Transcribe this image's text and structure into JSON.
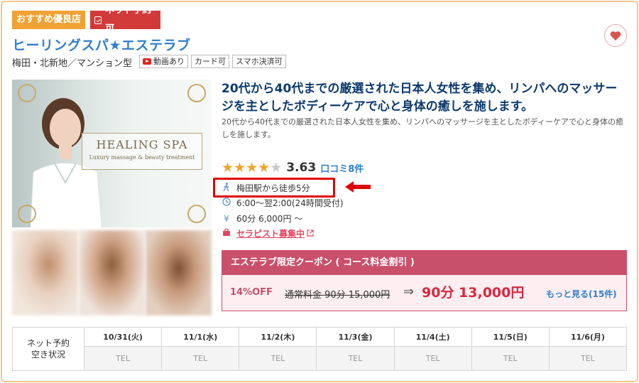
{
  "badges": {
    "recommended": "おすすめ優良店",
    "net_reserve": "ネット予約可"
  },
  "shop": {
    "name": "ヒーリングスパ★エステラブ",
    "area": "梅田・北新地／マンション型",
    "tags": [
      "動画あり",
      "カード可",
      "スマホ決済可"
    ]
  },
  "photo": {
    "title": "HEALING SPA",
    "subtitle": "Luxury massage & beauty treatment"
  },
  "headline": "20代から40代までの厳選された日本人女性を集め、リンパへのマッサージを主としたボディーケアで心と身体の癒しを施します。",
  "description": "20代から40代までの厳選された日本人女性を集め、リンパへのマッサージを主としたボディーケアで心と身体の癒しを施します。",
  "rating": {
    "stars": 4,
    "max": 5,
    "score": "3.63",
    "reviews": "口コミ8件"
  },
  "info": {
    "access": "梅田駅から徒歩5分",
    "hours": "6:00〜翌2:00(24時間受付)",
    "price": "60分 6,000円 〜",
    "recruit": "セラピスト募集中"
  },
  "coupon": {
    "header": "エステラブ限定クーポン ( コース料金割引 )",
    "discount": "14%OFF",
    "regular": "通常料金 90分 15,000円",
    "arrow": "⇒",
    "new_price": "90分 13,000円",
    "more": "もっと見る(15件)"
  },
  "schedule": {
    "label_line1": "ネット予約",
    "label_line2": "空き状況",
    "days": [
      "10/31(火)",
      "11/1(水)",
      "11/2(木)",
      "11/3(金)",
      "11/4(土)",
      "11/5(日)",
      "11/6(月)"
    ],
    "slots": [
      "TEL",
      "TEL",
      "TEL",
      "TEL",
      "TEL",
      "TEL",
      "TEL"
    ]
  },
  "colors": {
    "accent_blue": "#2f7fcf",
    "coupon_pink": "#c9506b",
    "star": "#f2a22a",
    "highlight_red": "#e00000"
  }
}
